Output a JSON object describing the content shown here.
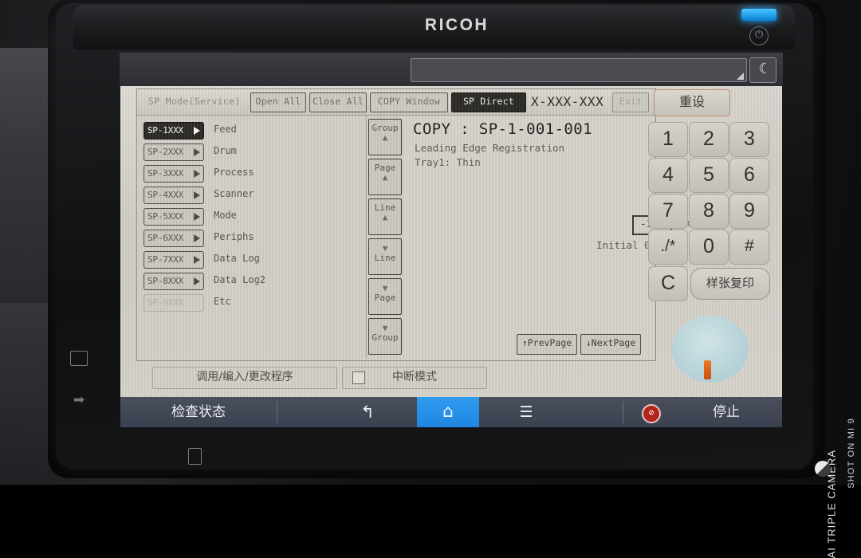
{
  "device": {
    "brand": "RICOH",
    "power_icon": "power-eco-icon",
    "led_indicator": "status-led",
    "moon_icon": "☾",
    "bezel_icons": [
      "fax-icon",
      "data-in-icon",
      "document-feed-icon"
    ]
  },
  "watermark": {
    "line1": "SHOT ON MI 9",
    "line2": "AI TRIPLE CAMERA"
  },
  "sp_window": {
    "title": "SP Mode(Service)",
    "toolbar": [
      {
        "label": "Open All",
        "state": "normal"
      },
      {
        "label": "Close All",
        "state": "normal"
      },
      {
        "label": "COPY Window",
        "state": "normal"
      },
      {
        "label": "SP Direct",
        "state": "selected"
      }
    ],
    "code": "X-XXX-XXX",
    "exit_label": "Exit",
    "groups": [
      {
        "key": "SP-1XXX",
        "label": "Feed",
        "state": "selected"
      },
      {
        "key": "SP-2XXX",
        "label": "Drum",
        "state": "normal"
      },
      {
        "key": "SP-3XXX",
        "label": "Process",
        "state": "normal"
      },
      {
        "key": "SP-4XXX",
        "label": "Scanner",
        "state": "normal"
      },
      {
        "key": "SP-5XXX",
        "label": "Mode",
        "state": "normal"
      },
      {
        "key": "SP-6XXX",
        "label": "Periphs",
        "state": "normal"
      },
      {
        "key": "SP-7XXX",
        "label": "Data Log",
        "state": "normal"
      },
      {
        "key": "SP-8XXX",
        "label": "Data Log2",
        "state": "normal"
      },
      {
        "key": "SP-9XXX",
        "label": "Etc",
        "state": "disabled"
      }
    ],
    "scroll_buttons": [
      {
        "text": "Group",
        "arrow": "▲",
        "arrow_first": false
      },
      {
        "text": "Page",
        "arrow": "▲",
        "arrow_first": false
      },
      {
        "text": "Line",
        "arrow": "▲",
        "arrow_first": false
      },
      {
        "text": "Line",
        "arrow": "▼",
        "arrow_first": true
      },
      {
        "text": "Page",
        "arrow": "▼",
        "arrow_first": true
      },
      {
        "text": "Group",
        "arrow": "▼",
        "arrow_first": true
      }
    ],
    "detail": {
      "title": "COPY : SP-1-001-001",
      "description": "Leading Edge Registration",
      "tray": "Tray1: Thin",
      "value": "-1.1",
      "unit": "mm",
      "initial_label": "Initial",
      "initial_value": "0.0",
      "prev_page": "↑PrevPage",
      "next_page": "↓NextPage"
    }
  },
  "lcd_bottom": {
    "program_button": "调用/编入/更改程序",
    "interrupt_label": "中断模式",
    "interrupt_checked": false
  },
  "keypad": {
    "reset_label": "重设",
    "keys": [
      "1",
      "2",
      "3",
      "4",
      "5",
      "6",
      "7",
      "8",
      "9",
      "./*",
      "0",
      "#"
    ],
    "clear_label": "C",
    "sample_copy_label": "样张复印",
    "start_label": "开始"
  },
  "navbar": {
    "check_status": "检查状态",
    "back_icon": "↰",
    "home_icon": "⌂",
    "menu_icon": "☰",
    "stop_icon": "⊘",
    "stop_label": "停止"
  },
  "colors": {
    "accent_blue": "#2f9bf0",
    "led_blue": "#49c6ff",
    "stop_red": "#b3241d",
    "start_orange": "#f07a22",
    "lcd_bg": "#d4d1c9"
  }
}
